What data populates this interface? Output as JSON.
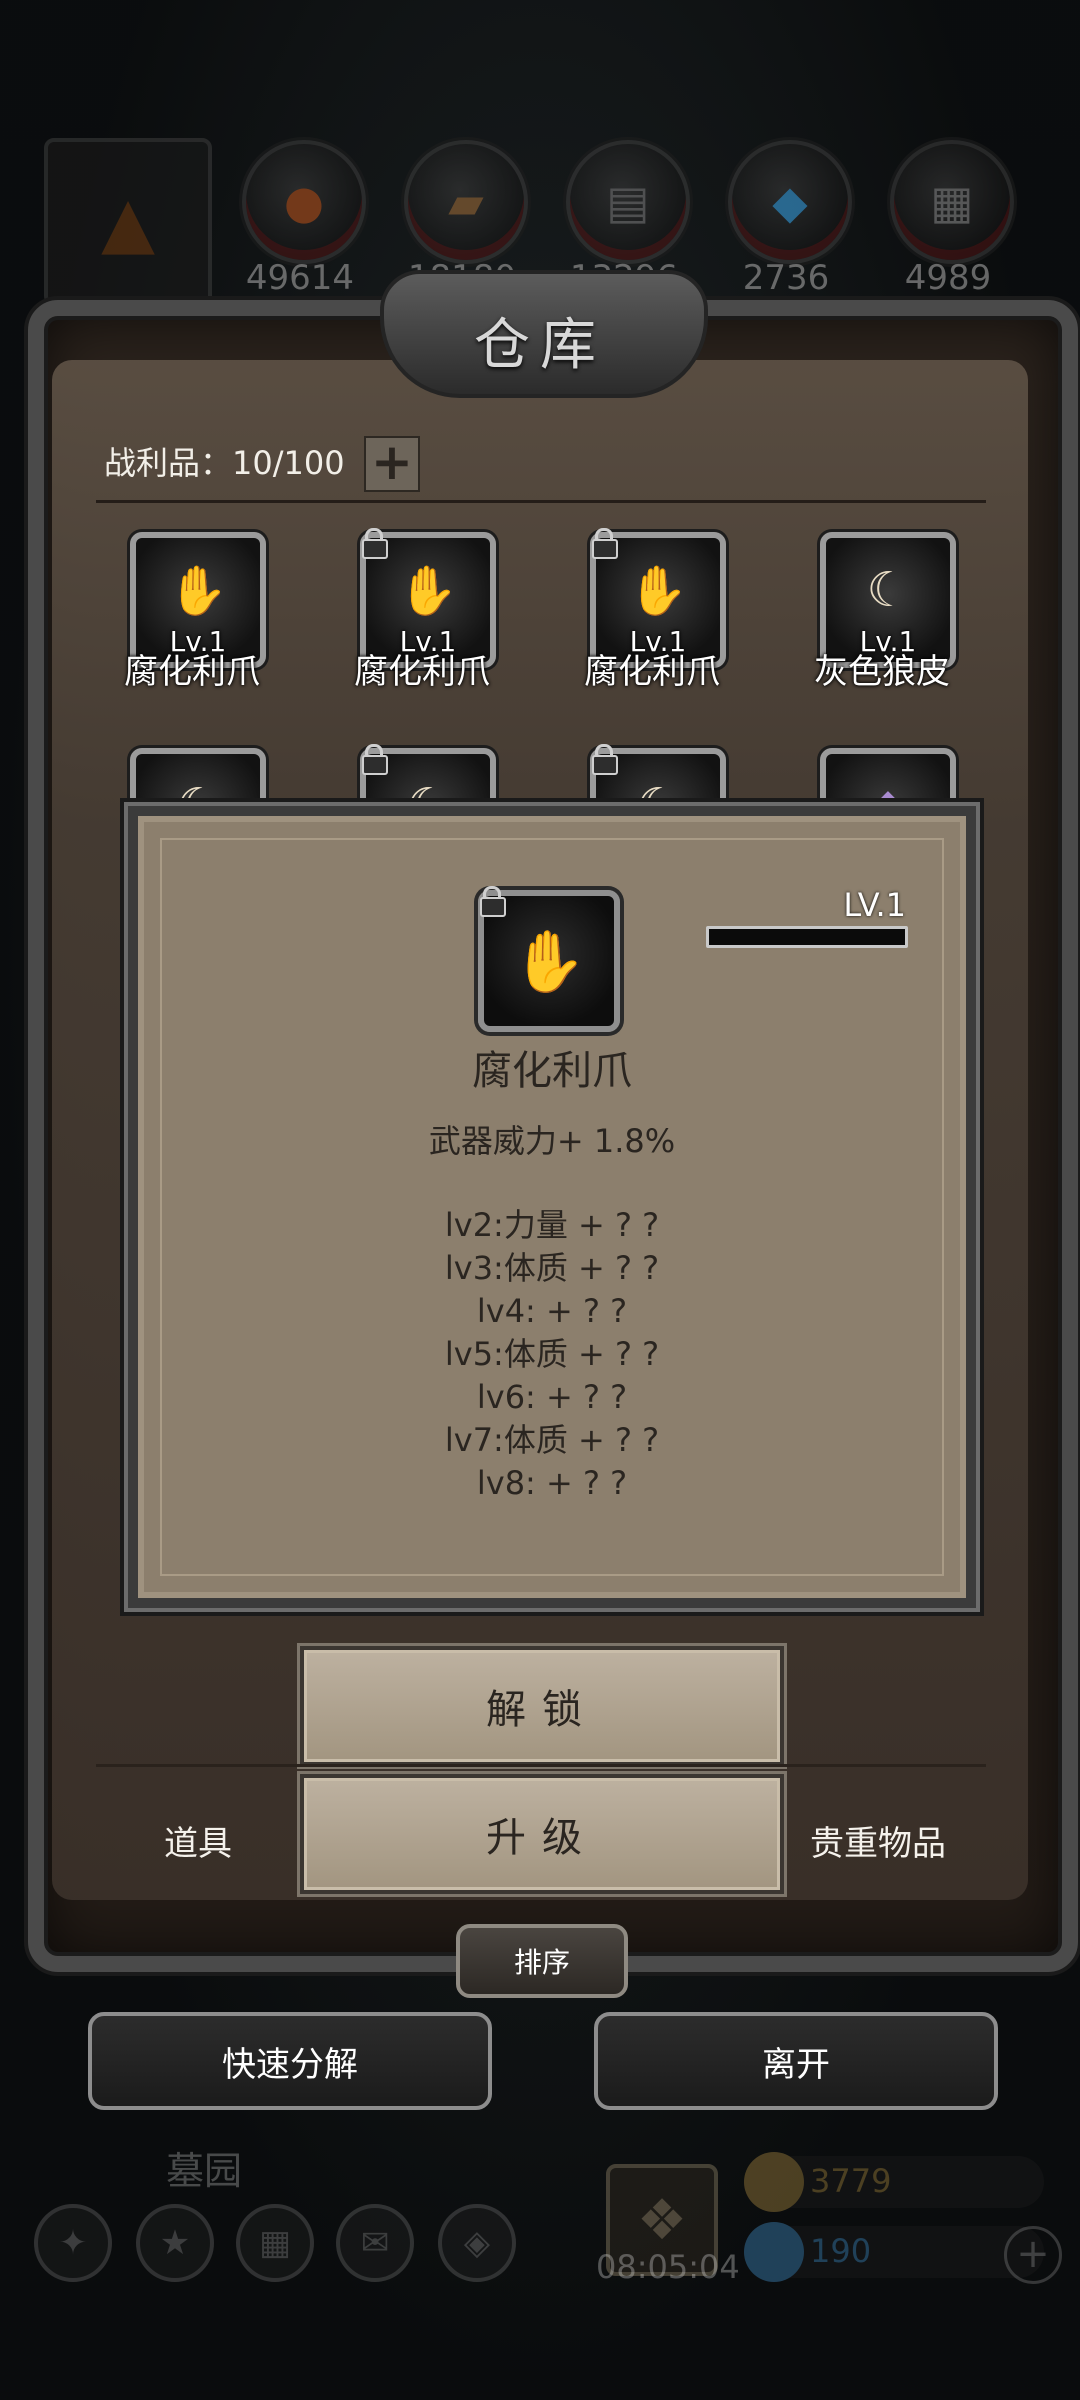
{
  "resources": {
    "counts": [
      "49614",
      "18180",
      "13296",
      "2736",
      "4989"
    ],
    "icons": [
      "meat-icon",
      "wood-icon",
      "iron-icon",
      "crystal-icon",
      "stone-icon"
    ]
  },
  "warehouse": {
    "title": "仓库",
    "loot_label": "战利品：10/100",
    "expand_symbol": "+"
  },
  "items": [
    {
      "name": "腐化利爪",
      "level": "Lv.1",
      "locked": false,
      "icon": "claw-icon"
    },
    {
      "name": "腐化利爪",
      "level": "Lv.1",
      "locked": true,
      "icon": "claw-icon"
    },
    {
      "name": "腐化利爪",
      "level": "Lv.1",
      "locked": true,
      "icon": "claw-icon"
    },
    {
      "name": "灰色狼皮",
      "level": "Lv.1",
      "locked": false,
      "icon": "wolf-pelt-icon"
    }
  ],
  "second_row_icons": [
    "wolf-pelt-icon",
    "wolf-pelt-icon",
    "wolf-pelt-icon",
    "purple-gem-icon"
  ],
  "detail": {
    "level": "LV.1",
    "level_progress": 0,
    "name": "腐化利爪",
    "bonus": "武器威力+ 1.8%",
    "lines": [
      "lv2:力量 + ? ?",
      "lv3:体质 + ? ?",
      "lv4: + ? ?",
      "lv5:体质 + ? ?",
      "lv6: + ? ?",
      "lv7:体质 + ? ?",
      "lv8: + ? ?"
    ]
  },
  "actions": {
    "unlock": "解锁",
    "upgrade": "升级"
  },
  "tabs": {
    "left": "道具",
    "right": "贵重物品"
  },
  "sort_label": "排序",
  "bottom": {
    "quick_decompose": "快速分解",
    "leave": "离开"
  },
  "hud": {
    "area_name": "墓园",
    "timer": "08:05:04",
    "gold": "3779",
    "gems": "190"
  },
  "colors": {
    "panel_bg": "#463c33",
    "popup_bg": "#8c7f6d",
    "button_bg": "#bdb1a0",
    "gold_text": "#c8a04a",
    "gem_text": "#4aa3e6"
  }
}
